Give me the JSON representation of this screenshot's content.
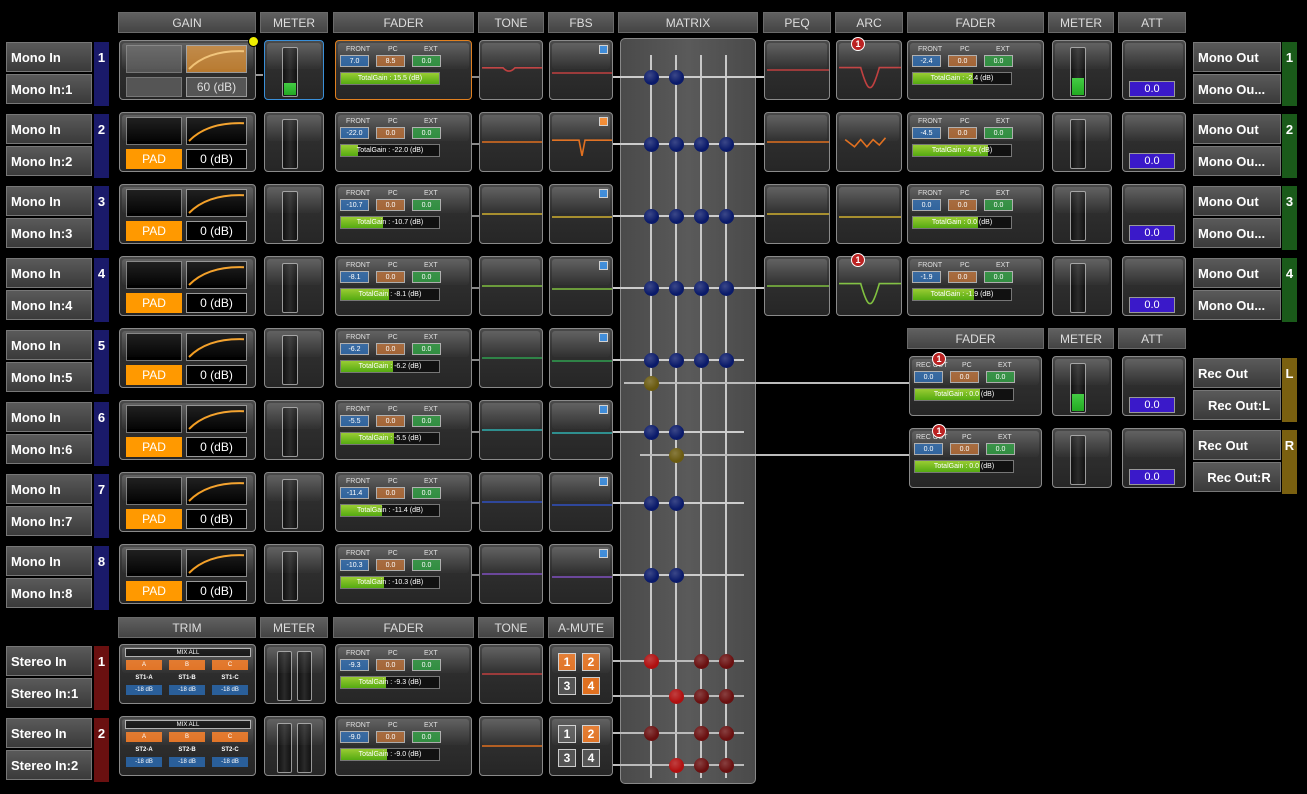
{
  "headers": {
    "gain": "GAIN",
    "meter": "METER",
    "fader": "FADER",
    "tone": "TONE",
    "fbs": "FBS",
    "matrix": "MATRIX",
    "peq": "PEQ",
    "arc": "ARC",
    "fader_out": "FADER",
    "meter_out": "METER",
    "att": "ATT",
    "trim": "TRIM",
    "meter_st": "METER",
    "fader_st": "FADER",
    "tone_st": "TONE",
    "amute": "A-MUTE",
    "rec_fader": "FADER",
    "rec_meter": "METER",
    "rec_att": "ATT"
  },
  "fader_labels": {
    "front": "FRONT",
    "pc": "PC",
    "ext": "EXT",
    "rec_out": "REC OUT",
    "total_prefix": "TotalGain : ",
    "unit": "(dB)"
  },
  "mono_inputs": [
    {
      "label": "Mono In",
      "name": "Mono In:1",
      "num": "1",
      "gain": "60 (dB)",
      "pad": "",
      "front": "7.0",
      "pc": "8.5",
      "ext": "0.0",
      "total": "15.5",
      "tone_color": "#c04040",
      "fbs_color": "#c04040",
      "fbs_ind": "#2a7fd4"
    },
    {
      "label": "Mono In",
      "name": "Mono In:2",
      "num": "2",
      "gain": "0 (dB)",
      "pad": "PAD",
      "front": "-22.0",
      "pc": "0.0",
      "ext": "0.0",
      "total": "-22.0",
      "tone_color": "#e07020",
      "fbs_color": "#e07020",
      "fbs_ind": "#f08020"
    },
    {
      "label": "Mono In",
      "name": "Mono In:3",
      "num": "3",
      "gain": "0 (dB)",
      "pad": "PAD",
      "front": "-10.7",
      "pc": "0.0",
      "ext": "0.0",
      "total": "-10.7",
      "tone_color": "#d0b030",
      "fbs_color": "#d0b030",
      "fbs_ind": "#2a7fd4"
    },
    {
      "label": "Mono In",
      "name": "Mono In:4",
      "num": "4",
      "gain": "0 (dB)",
      "pad": "PAD",
      "front": "-8.1",
      "pc": "0.0",
      "ext": "0.0",
      "total": "-8.1",
      "tone_color": "#80c040",
      "fbs_color": "#80c040",
      "fbs_ind": "#2a7fd4"
    },
    {
      "label": "Mono In",
      "name": "Mono In:5",
      "num": "5",
      "gain": "0 (dB)",
      "pad": "PAD",
      "front": "-6.2",
      "pc": "0.0",
      "ext": "0.0",
      "total": "-6.2",
      "tone_color": "#30a050",
      "fbs_color": "#30a050",
      "fbs_ind": "#2a7fd4"
    },
    {
      "label": "Mono In",
      "name": "Mono In:6",
      "num": "6",
      "gain": "0 (dB)",
      "pad": "PAD",
      "front": "-5.5",
      "pc": "0.0",
      "ext": "0.0",
      "total": "-5.5",
      "tone_color": "#30b0b0",
      "fbs_color": "#30b0b0",
      "fbs_ind": "#2a7fd4"
    },
    {
      "label": "Mono In",
      "name": "Mono In:7",
      "num": "7",
      "gain": "0 (dB)",
      "pad": "PAD",
      "front": "-11.4",
      "pc": "0.0",
      "ext": "0.0",
      "total": "-11.4",
      "tone_color": "#3050c0",
      "fbs_color": "#3050c0",
      "fbs_ind": "#2a7fd4"
    },
    {
      "label": "Mono In",
      "name": "Mono In:8",
      "num": "8",
      "gain": "0 (dB)",
      "pad": "PAD",
      "front": "-10.3",
      "pc": "0.0",
      "ext": "0.0",
      "total": "-10.3",
      "tone_color": "#8050c0",
      "fbs_color": "#8050c0",
      "fbs_ind": "#2a7fd4"
    }
  ],
  "stereo_inputs": [
    {
      "label": "Stereo In",
      "name": "Stereo In:1",
      "num": "1",
      "mix_all": "MIX ALL",
      "a": "A",
      "b": "B",
      "c": "C",
      "st_a": "ST1-A",
      "st_b": "ST1-B",
      "st_c": "ST1-C",
      "db": "-18 dB",
      "front": "-9.3",
      "pc": "0.0",
      "ext": "0.0",
      "total": "-9.3",
      "tone_color": "#c04040",
      "mute": [
        "1",
        "2",
        "3",
        "4"
      ],
      "mute_on": [
        true,
        true,
        false,
        true
      ]
    },
    {
      "label": "Stereo In",
      "name": "Stereo In:2",
      "num": "2",
      "mix_all": "MIX ALL",
      "a": "A",
      "b": "B",
      "c": "C",
      "st_a": "ST2-A",
      "st_b": "ST2-B",
      "st_c": "ST2-C",
      "db": "-18 dB",
      "front": "-9.0",
      "pc": "0.0",
      "ext": "0.0",
      "total": "-9.0",
      "tone_color": "#e07020",
      "mute": [
        "1",
        "2",
        "3",
        "4"
      ],
      "mute_on": [
        false,
        true,
        false,
        false
      ]
    }
  ],
  "mono_outputs": [
    {
      "label": "Mono Out",
      "name": "Mono Ou...",
      "num": "1",
      "front": "-2.4",
      "pc": "0.0",
      "ext": "0.0",
      "total": "-2.4",
      "att": "0.0",
      "peq_color": "#c04040",
      "arc_color": "#c04040",
      "badge": "1"
    },
    {
      "label": "Mono Out",
      "name": "Mono Ou...",
      "num": "2",
      "front": "-4.5",
      "pc": "0.0",
      "ext": "0.0",
      "total": "4.5",
      "att": "0.0",
      "peq_color": "#e07020",
      "arc_color": "#e07020",
      "badge": ""
    },
    {
      "label": "Mono Out",
      "name": "Mono Ou...",
      "num": "3",
      "front": "0.0",
      "pc": "0.0",
      "ext": "0.0",
      "total": "0.0",
      "att": "0.0",
      "peq_color": "#d0b030",
      "arc_color": "#d0b030",
      "badge": ""
    },
    {
      "label": "Mono Out",
      "name": "Mono Ou...",
      "num": "4",
      "front": "-1.9",
      "pc": "0.0",
      "ext": "0.0",
      "total": "-1.9",
      "att": "0.0",
      "peq_color": "#80c040",
      "arc_color": "#80c040",
      "badge": "1"
    }
  ],
  "rec_outputs": [
    {
      "label": "Rec Out",
      "name": "Rec Out:L",
      "num": "L",
      "rec": "0.0",
      "pc": "0.0",
      "ext": "0.0",
      "total": "0.0",
      "att": "0.0",
      "badge": "1"
    },
    {
      "label": "Rec Out",
      "name": "Rec Out:R",
      "num": "R",
      "rec": "0.0",
      "pc": "0.0",
      "ext": "0.0",
      "total": "0.0",
      "att": "0.0",
      "badge": "1"
    }
  ],
  "colors": {
    "mono_in_num": "#1a1a6a",
    "stereo_num": "#6a1010",
    "mono_out_num": "#1a5a1a",
    "rec_num": "#7a6010",
    "node_mono": "#0a1a6a",
    "node_rec": "#6a5a10",
    "node_stereo": "#b01010",
    "node_stereo_dark": "#6a1010",
    "att": "#3a19c9",
    "pad": "#ff9900"
  }
}
